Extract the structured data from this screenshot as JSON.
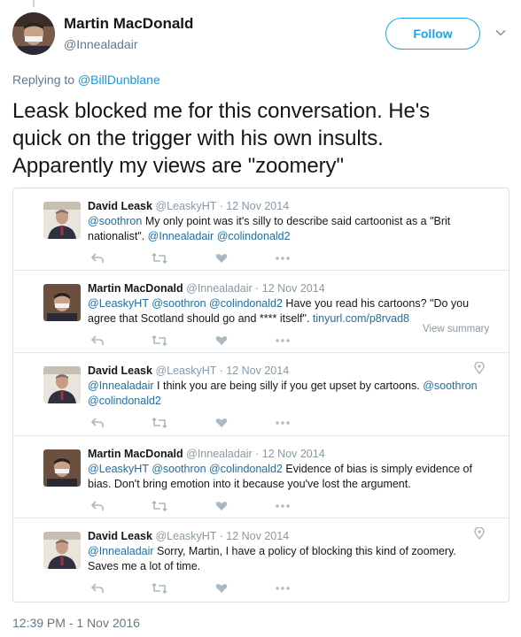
{
  "tweet": {
    "author_name": "Martin MacDonald",
    "author_handle": "@Innealadair",
    "follow_label": "Follow",
    "replying_prefix": "Replying to",
    "replying_to": "@BillDunblane",
    "text_line1": "Leask blocked me for this conversation. He's",
    "text_line2": "quick on the trigger with his own insults.",
    "text_line3": "Apparently my views are \"zoomery\"",
    "timestamp": "12:39 PM - 1 Nov 2016"
  },
  "conversation": [
    {
      "name": "David Leask",
      "meta": "@LeaskyHT · 12 Nov 2014",
      "line1": [
        {
          "t": "@soothron",
          "l": true
        },
        {
          "t": " My only point was it's silly to describe said cartoonist as a \"Brit",
          "l": false
        }
      ],
      "line2": [
        {
          "t": "nationalist\". ",
          "l": false
        },
        {
          "t": "@Innealadair",
          "l": true
        },
        {
          "t": " ",
          "l": false
        },
        {
          "t": "@colindonald2",
          "l": true
        }
      ],
      "geo": false,
      "summary": ""
    },
    {
      "name": "Martin MacDonald",
      "meta": "@Innealadair · 12 Nov 2014",
      "line1": [
        {
          "t": "@LeaskyHT",
          "l": true
        },
        {
          "t": " ",
          "l": false
        },
        {
          "t": "@soothron",
          "l": true
        },
        {
          "t": " ",
          "l": false
        },
        {
          "t": "@colindonald2",
          "l": true
        },
        {
          "t": " Have you read his cartoons? \"Do you",
          "l": false
        }
      ],
      "line2": [
        {
          "t": "agree that Scotland should go and **** itself\". ",
          "l": false
        },
        {
          "t": "tinyurl.com/p8rvad8",
          "l": true
        }
      ],
      "geo": false,
      "summary": "View summary"
    },
    {
      "name": "David Leask",
      "meta": "@LeaskyHT · 12 Nov 2014",
      "line1": [
        {
          "t": "@Innealadair",
          "l": true
        },
        {
          "t": " I think you are being silly if you get upset by cartoons. ",
          "l": false
        },
        {
          "t": "@soothron",
          "l": true
        }
      ],
      "line2": [
        {
          "t": "@colindonald2",
          "l": true
        }
      ],
      "geo": true,
      "summary": ""
    },
    {
      "name": "Martin MacDonald",
      "meta": "@Innealadair · 12 Nov 2014",
      "line1": [
        {
          "t": "@LeaskyHT",
          "l": true
        },
        {
          "t": " ",
          "l": false
        },
        {
          "t": "@soothron",
          "l": true
        },
        {
          "t": " ",
          "l": false
        },
        {
          "t": "@colindonald2",
          "l": true
        },
        {
          "t": " Evidence of bias is simply evidence of",
          "l": false
        }
      ],
      "line2": [
        {
          "t": "bias. Don't bring emotion into it because you've lost the argument.",
          "l": false
        }
      ],
      "geo": false,
      "summary": ""
    },
    {
      "name": "David Leask",
      "meta": "@LeaskyHT · 12 Nov 2014",
      "line1": [
        {
          "t": "@Innealadair",
          "l": true
        },
        {
          "t": " Sorry, Martin, I have a policy of blocking this kind of zoomery.",
          "l": false
        }
      ],
      "line2": [
        {
          "t": "Saves me a lot of time.",
          "l": false
        }
      ],
      "geo": true,
      "summary": ""
    }
  ],
  "icons": {
    "reply": "reply-icon",
    "retweet": "retweet-icon",
    "like": "heart-icon",
    "more": "more-icon",
    "geo": "location-pin-icon",
    "caret": "chevron-down-icon"
  },
  "colors": {
    "accent": "#1da1f2",
    "link": "#1b6fa8",
    "muted": "#8899a6",
    "icon": "#aab8c2"
  }
}
